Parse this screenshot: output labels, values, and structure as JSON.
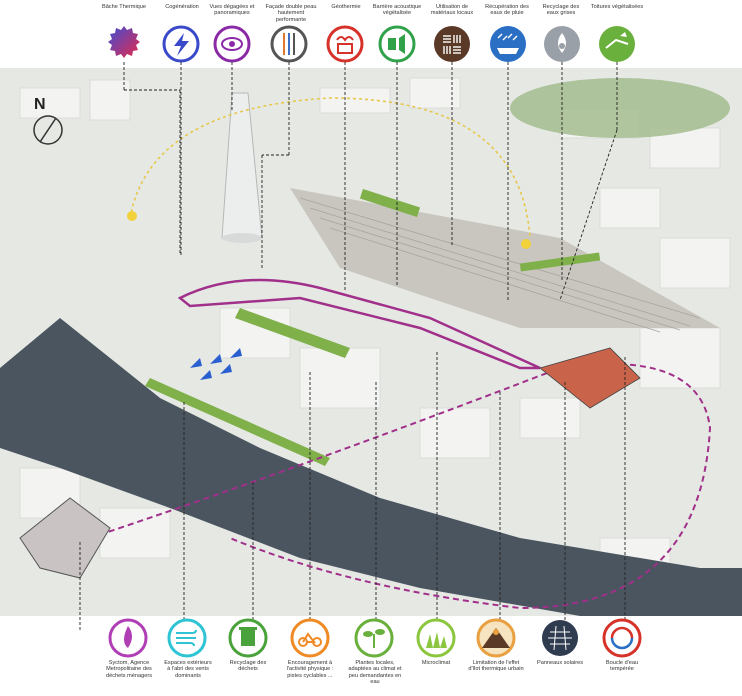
{
  "top_icons": [
    {
      "label": "Bâche Thermique",
      "icon": "thermal-tarp-icon",
      "color": "#8e3fd6"
    },
    {
      "label": "Cogénération",
      "icon": "lightning-icon",
      "color": "#3a49c9"
    },
    {
      "label": "Vues dégagées et panoramiques",
      "icon": "eye-icon",
      "color": "#8a2aa6"
    },
    {
      "label": "Façade double peau hautement performante",
      "icon": "double-facade-icon",
      "color": "#e07a2a"
    },
    {
      "label": "Géothermie",
      "icon": "geothermal-icon",
      "color": "#d6322a"
    },
    {
      "label": "Barrière acoustique végétalisée",
      "icon": "acoustic-barrier-icon",
      "color": "#2fa24a"
    },
    {
      "label": "Utilisation de matériaux locaux",
      "icon": "local-materials-icon",
      "color": "#5a3a26"
    },
    {
      "label": "Récupération des eaux de pluie",
      "icon": "rainwater-icon",
      "color": "#2a6fc4"
    },
    {
      "label": "Recyclage des eaux grises",
      "icon": "greywater-icon",
      "color": "#9aa0a8"
    },
    {
      "label": "Toitures végétalisées",
      "icon": "green-roof-icon",
      "color": "#6ab03c"
    }
  ],
  "bottom_icons": [
    {
      "label": "Syctom, Agence Metropolitaine des déchets ménagers",
      "icon": "incinerator-flame-icon",
      "color": "#b03fb6"
    },
    {
      "label": "Espaces extérieurs à l'abri des vents dominants",
      "icon": "wind-icon",
      "color": "#2ec4d4"
    },
    {
      "label": "Recyclage des déchets",
      "icon": "recycle-bin-icon",
      "color": "#4aa23a"
    },
    {
      "label": "Encouragement à l'activité physique : pistes cyclables ...",
      "icon": "bicycle-icon",
      "color": "#f08a24"
    },
    {
      "label": "Plantes locales, adaptées au climat et peu demandantes en eau",
      "icon": "plant-icon",
      "color": "#6ab03c"
    },
    {
      "label": "Microclimat",
      "icon": "microclimate-grass-icon",
      "color": "#8cc63f"
    },
    {
      "label": "Limitation de l'effet d'îlot thermique urbain",
      "icon": "heat-island-icon",
      "color": "#e8a040"
    },
    {
      "label": "Panneaux solaires",
      "icon": "solar-panel-icon",
      "color": "#2f3c50"
    },
    {
      "label": "Boucle d'eau tempérée",
      "icon": "water-loop-icon",
      "color": "#d6322a"
    }
  ],
  "map": {
    "north_label": "N",
    "river_color": "#4a5560",
    "greenery_color": "#7fb04a",
    "loop_color": "#a0308a",
    "thermal_arc_color": "#e6c84a"
  }
}
